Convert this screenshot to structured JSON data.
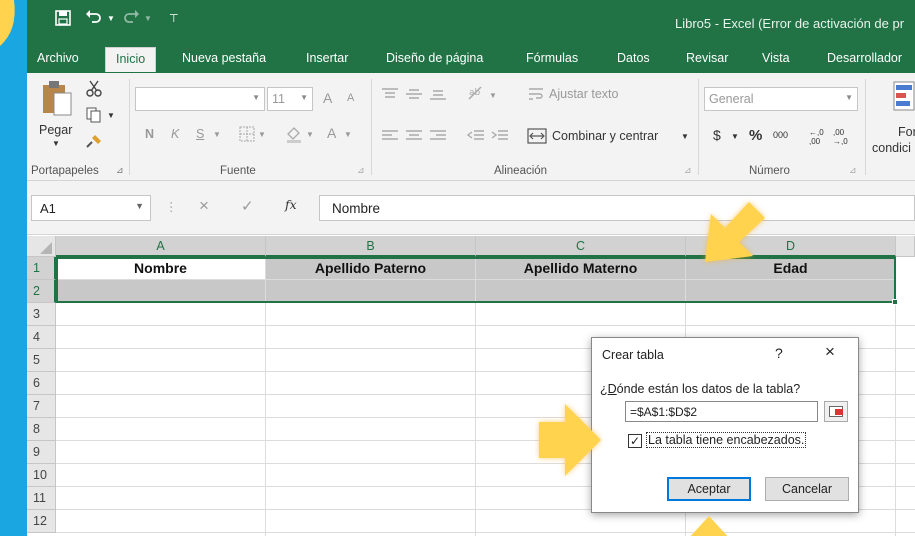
{
  "window": {
    "title": "Libro5 - Excel (Error de activación de pr"
  },
  "quick_access": {
    "save_icon": "save-icon",
    "undo_icon": "undo-icon",
    "redo_icon": "redo-icon",
    "customize_icon": "customize-icon"
  },
  "tabs": [
    {
      "label": "Archivo"
    },
    {
      "label": "Inicio"
    },
    {
      "label": "Nueva pestaña"
    },
    {
      "label": "Insertar"
    },
    {
      "label": "Diseño de página"
    },
    {
      "label": "Fórmulas"
    },
    {
      "label": "Datos"
    },
    {
      "label": "Revisar"
    },
    {
      "label": "Vista"
    },
    {
      "label": "Desarrollador"
    }
  ],
  "ribbon": {
    "clipboard": {
      "paste_label": "Pegar",
      "group_label": "Portapapeles"
    },
    "font": {
      "font_size": "11",
      "bold": "N",
      "italic": "K",
      "underline": "S",
      "grow": "A",
      "shrink": "A",
      "color": "A",
      "group_label": "Fuente"
    },
    "alignment": {
      "wrap_label": "Ajustar texto",
      "merge_label": "Combinar y centrar",
      "group_label": "Alineación"
    },
    "number": {
      "format": "General",
      "currency": "$",
      "percent": "%",
      "thousands": "000",
      "inc_dec": "←,0 ,00",
      "dec_dec": ",00 →,0",
      "group_label": "Número"
    },
    "styles": {
      "cond_label_1": "Form",
      "cond_label_2": "condici"
    }
  },
  "formula_bar": {
    "name_box": "A1",
    "cancel": "×",
    "enter": "✓",
    "fx": "fx",
    "value": "Nombre"
  },
  "sheet": {
    "columns": [
      "A",
      "B",
      "C",
      "D"
    ],
    "rows": [
      "1",
      "2",
      "3",
      "4",
      "5",
      "6",
      "7",
      "8",
      "9",
      "10",
      "11",
      "12"
    ],
    "header_cells": [
      "Nombre",
      "Apellido Paterno",
      "Apellido Materno",
      "Edad"
    ]
  },
  "dialog": {
    "title": "Crear tabla",
    "help": "?",
    "close": "×",
    "question": "¿Dónde están los datos de la tabla?",
    "range": "=$A$1:$D$2",
    "checkbox_label": "La tabla tiene encabezados.",
    "checked": true,
    "ok_label": "Aceptar",
    "cancel_label": "Cancelar"
  },
  "colors": {
    "excel_green": "#217346",
    "highlight": "#ffd34d",
    "background": "#1aa6e0"
  }
}
